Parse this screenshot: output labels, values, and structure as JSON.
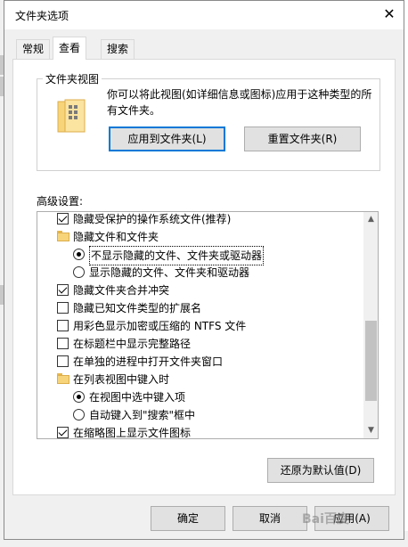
{
  "window": {
    "title": "文件夹选项",
    "close_glyph": "✕"
  },
  "tabs": [
    {
      "label": "常规",
      "active": false
    },
    {
      "label": "查看",
      "active": true
    },
    {
      "label": "搜索",
      "active": false
    }
  ],
  "folder_views": {
    "legend": "文件夹视图",
    "description": "你可以将此视图(如详细信息或图标)应用于这种类型的所有文件夹。",
    "apply_button": "应用到文件夹(L)",
    "reset_button": "重置文件夹(R)"
  },
  "advanced": {
    "label": "高级设置:",
    "items": [
      {
        "kind": "checkbox",
        "checked": true,
        "indent": 0,
        "label": "隐藏受保护的操作系统文件(推荐)"
      },
      {
        "kind": "folder",
        "indent": 0,
        "label": "隐藏文件和文件夹"
      },
      {
        "kind": "radio",
        "checked": true,
        "indent": 1,
        "label": "不显示隐藏的文件、文件夹或驱动器",
        "focused": true
      },
      {
        "kind": "radio",
        "checked": false,
        "indent": 1,
        "label": "显示隐藏的文件、文件夹和驱动器"
      },
      {
        "kind": "checkbox",
        "checked": true,
        "indent": 0,
        "label": "隐藏文件夹合并冲突"
      },
      {
        "kind": "checkbox",
        "checked": false,
        "indent": 0,
        "label": "隐藏已知文件类型的扩展名"
      },
      {
        "kind": "checkbox",
        "checked": false,
        "indent": 0,
        "label": "用彩色显示加密或压缩的 NTFS 文件"
      },
      {
        "kind": "checkbox",
        "checked": false,
        "indent": 0,
        "label": "在标题栏中显示完整路径"
      },
      {
        "kind": "checkbox",
        "checked": false,
        "indent": 0,
        "label": "在单独的进程中打开文件夹窗口"
      },
      {
        "kind": "folder",
        "indent": 0,
        "label": "在列表视图中键入时"
      },
      {
        "kind": "radio",
        "checked": true,
        "indent": 1,
        "label": "在视图中选中键入项"
      },
      {
        "kind": "radio",
        "checked": false,
        "indent": 1,
        "label": "自动键入到\"搜索\"框中"
      },
      {
        "kind": "checkbox",
        "checked": true,
        "indent": 0,
        "label": "在缩略图上显示文件图标"
      }
    ],
    "restore_button": "还原为默认值(D)"
  },
  "footer": {
    "ok": "确定",
    "cancel": "取消",
    "apply": "应用(A)",
    "watermark": "Bai百度"
  },
  "colors": {
    "focus_border": "#0078d7",
    "folder_yellow": "#f7d47a",
    "dialog_bg": "#f0f0f0"
  }
}
